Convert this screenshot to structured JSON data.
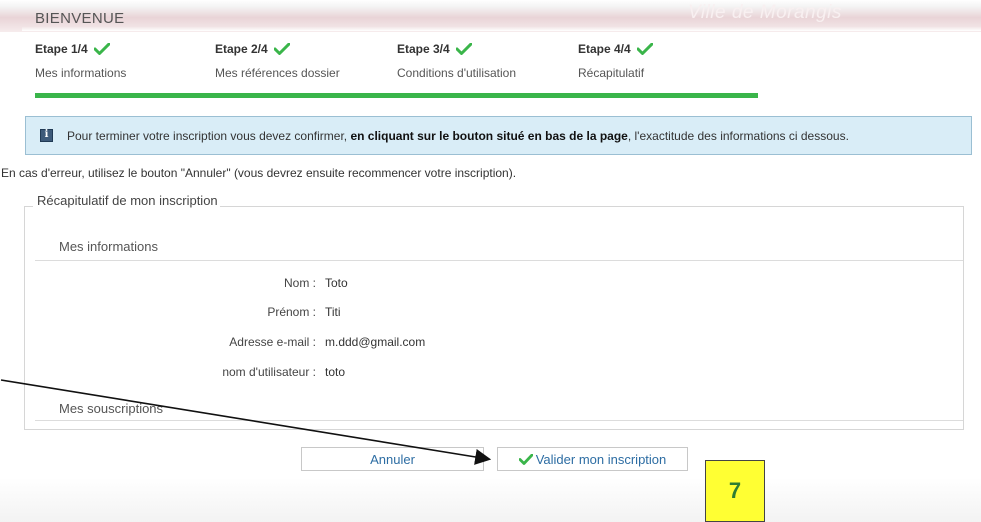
{
  "header": {
    "title": "BIENVENUE",
    "brand": "Ville de Morangis"
  },
  "steps": [
    {
      "title": "Etape 1/4",
      "subtitle": "Mes informations"
    },
    {
      "title": "Etape 2/4",
      "subtitle": "Mes références dossier"
    },
    {
      "title": "Etape 3/4",
      "subtitle": "Conditions d'utilisation"
    },
    {
      "title": "Etape 4/4",
      "subtitle": "Récapitulatif"
    }
  ],
  "progress": {
    "completed_steps": 4,
    "total_steps": 4
  },
  "info": {
    "icon": "info-icon",
    "text_before": "Pour terminer votre inscription vous devez confirmer, ",
    "text_bold": "en cliquant sur le bouton situé en bas de la page",
    "text_after": ", l'exactitude des informations ci dessous."
  },
  "error_note": "En cas d'erreur, utilisez le bouton \"Annuler\" (vous devrez ensuite recommencer votre inscription).",
  "recap": {
    "legend": "Récapitulatif de mon inscription",
    "section_info_title": "Mes informations",
    "fields": [
      {
        "label": "Nom :",
        "value": "Toto"
      },
      {
        "label": "Prénom :",
        "value": "Titi"
      },
      {
        "label": "Adresse e-mail :",
        "value": "m.ddd@gmail.com"
      },
      {
        "label": "nom d'utilisateur :",
        "value": "toto"
      }
    ],
    "section_subscriptions_title": "Mes souscriptions"
  },
  "buttons": {
    "cancel": "Annuler",
    "validate": "Valider mon inscription"
  },
  "callout": {
    "number": "7"
  },
  "colors": {
    "progress": "#3ab54a",
    "check": "#3ab54a",
    "info_bg": "#d9edf7",
    "link_text": "#2d6da3",
    "callout_bg": "#ffff33"
  }
}
